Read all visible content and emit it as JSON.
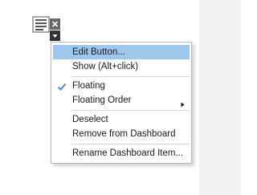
{
  "dashboard_item": {
    "icon": "text-object-icon",
    "close_icon": "close-icon",
    "dropdown_icon": "chevron-down-icon"
  },
  "context_menu": {
    "items": [
      {
        "label": "Edit Button...",
        "highlighted": true
      },
      {
        "label": "Show (Alt+click)"
      },
      {
        "label": "Floating",
        "checked": true
      },
      {
        "label": "Floating Order",
        "has_submenu": true
      },
      {
        "label": "Deselect"
      },
      {
        "label": "Remove from Dashboard"
      },
      {
        "label": "Rename Dashboard Item..."
      }
    ]
  },
  "colors": {
    "highlight": "#9ec7ee",
    "check": "#4a8fd6",
    "right_panel": "#f2f2f2"
  }
}
